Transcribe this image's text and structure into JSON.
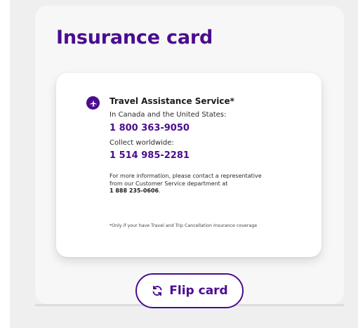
{
  "page": {
    "title": "Insurance card"
  },
  "card": {
    "service_title": "Travel Assistance Service*",
    "canada_us_label": "In Canada and the United States:",
    "canada_us_phone": "1 800 363-9050",
    "worldwide_label": "Collect worldwide:",
    "worldwide_phone": "1 514 985-2281",
    "info_line_1": "For more information, please contact a representative",
    "info_line_2": "from our Customer Service department at",
    "info_phone": "1 888 235-0606",
    "info_suffix": ".",
    "footnote": "*Only if your have Travel and Trip Cancellation Insurance coverage",
    "service_icon": "travel-assistance-icon"
  },
  "actions": {
    "flip_label": "Flip card",
    "flip_icon": "rotate-icon"
  },
  "colors": {
    "brand": "#4b0c8f",
    "panel": "#f7f7f7",
    "card": "#ffffff",
    "text": "#1c1c1c"
  }
}
